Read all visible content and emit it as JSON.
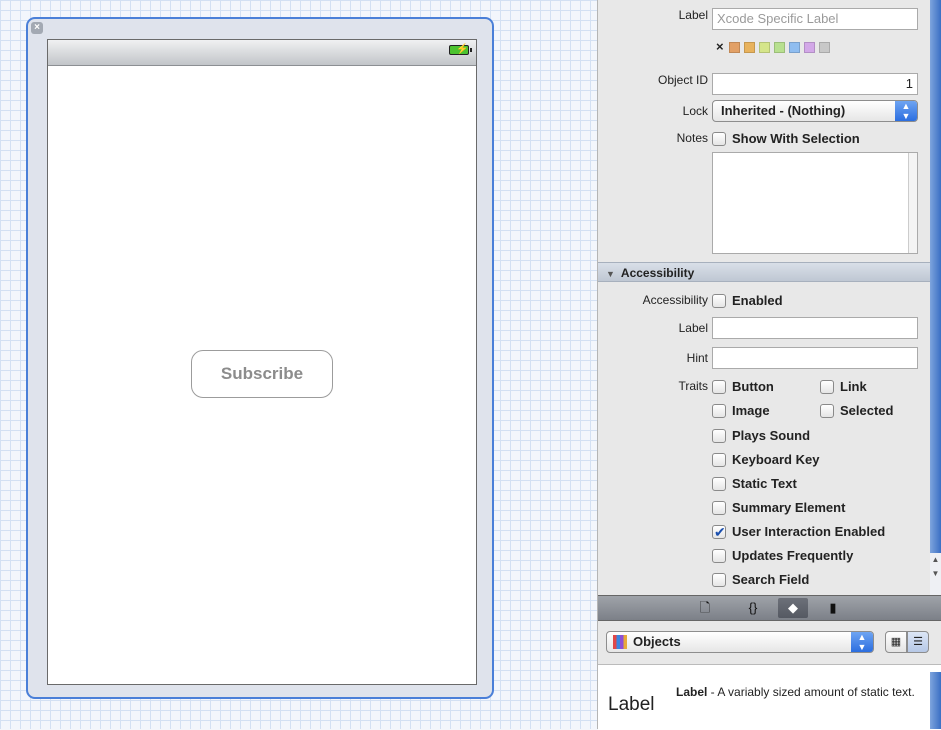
{
  "canvas": {
    "subscribe_label": "Subscribe"
  },
  "inspector": {
    "identity": {
      "label_label": "Label",
      "label_placeholder": "Xcode Specific Label",
      "clear_glyph": "×",
      "swatch_colors": [
        "#e2a066",
        "#e8b25c",
        "#d5e58a",
        "#b8e08f",
        "#8fbdf0",
        "#d3a8e8",
        "#c8c8c8"
      ],
      "object_id_label": "Object ID",
      "object_id_value": "1",
      "lock_label": "Lock",
      "lock_value": "Inherited - (Nothing)",
      "notes_label": "Notes",
      "show_with_selection": "Show With Selection"
    },
    "accessibility": {
      "header": "Accessibility",
      "accessibility_label": "Accessibility",
      "enabled_text": "Enabled",
      "label_label": "Label",
      "hint_label": "Hint",
      "traits_label": "Traits",
      "traits": [
        {
          "text": "Button",
          "checked": false
        },
        {
          "text": "Link",
          "checked": false
        },
        {
          "text": "Image",
          "checked": false
        },
        {
          "text": "Selected",
          "checked": false
        },
        {
          "text": "Plays Sound",
          "checked": false
        },
        {
          "text": "Keyboard Key",
          "checked": false
        },
        {
          "text": "Static Text",
          "checked": false
        },
        {
          "text": "Summary Element",
          "checked": false
        },
        {
          "text": "User Interaction Enabled",
          "checked": true
        },
        {
          "text": "Updates Frequently",
          "checked": false
        },
        {
          "text": "Search Field",
          "checked": false
        }
      ]
    }
  },
  "library": {
    "tab_icons": [
      "file-template-icon",
      "code-snippet-icon",
      "object-cube-icon",
      "media-film-icon"
    ],
    "objects_label": "Objects",
    "item": {
      "name": "Label",
      "title": "Label",
      "description": " - A variably sized amount of static text."
    }
  },
  "colors": {
    "selection_blue": "#4a7fd8",
    "check_blue": "#1b4fae"
  }
}
